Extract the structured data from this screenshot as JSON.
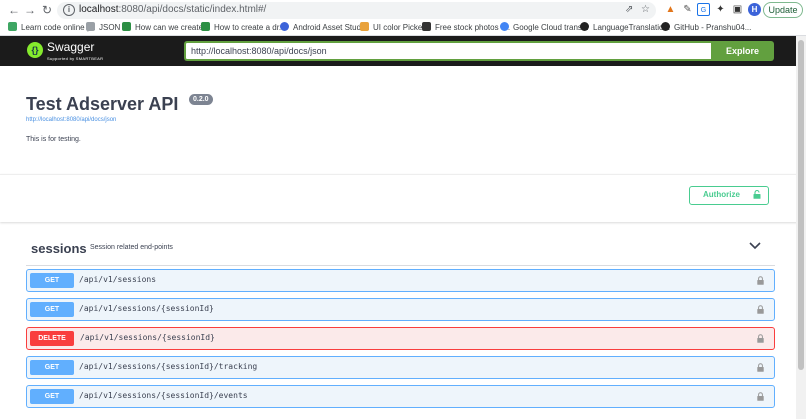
{
  "browser": {
    "url_host": "localhost",
    "url_path": ":8080/api/docs/static/index.html#/",
    "bookmarks": [
      {
        "label": "Learn code online |...",
        "color": "#3ea663"
      },
      {
        "label": "JSON",
        "color": "#9aa0a6"
      },
      {
        "label": "How can we create...",
        "color": "#2c8f44"
      },
      {
        "label": "How to create a dr...",
        "color": "#2c8f44"
      },
      {
        "label": "Android Asset Studi...",
        "color": "#3c63d9"
      },
      {
        "label": "UI color Picker",
        "color": "#e9a23b"
      },
      {
        "label": "Free stock photos -...",
        "color": "#333333"
      },
      {
        "label": "Google Cloud trans...",
        "color": "#4285f4"
      },
      {
        "label": "LanguageTranslatio...",
        "color": "#222222"
      },
      {
        "label": "GitHub - Pranshu04...",
        "color": "#222222"
      }
    ],
    "avatar_initial": "H",
    "update_label": "Update"
  },
  "topbar": {
    "logo_text": "Swagger",
    "logo_sub": "Supported by SMARTBEAR",
    "spec_url_value": "http://localhost:8080/api/docs/json",
    "explore_label": "Explore"
  },
  "info": {
    "title": "Test Adserver API",
    "version": "0.2.0",
    "spec_link": "http://localhost:8080/api/docs/json",
    "description": "This is for testing."
  },
  "authorize_label": "Authorize",
  "tag": {
    "name": "sessions",
    "description": "Session related end-points"
  },
  "operations": [
    {
      "method": "GET",
      "path": "/api/v1/sessions"
    },
    {
      "method": "GET",
      "path": "/api/v1/sessions/{sessionId}"
    },
    {
      "method": "DELETE",
      "path": "/api/v1/sessions/{sessionId}"
    },
    {
      "method": "GET",
      "path": "/api/v1/sessions/{sessionId}/tracking"
    },
    {
      "method": "GET",
      "path": "/api/v1/sessions/{sessionId}/events"
    }
  ],
  "colors": {
    "get": "#61affe",
    "delete": "#f93e3e",
    "authorize": "#49cc90",
    "explore": "#62a03f"
  }
}
